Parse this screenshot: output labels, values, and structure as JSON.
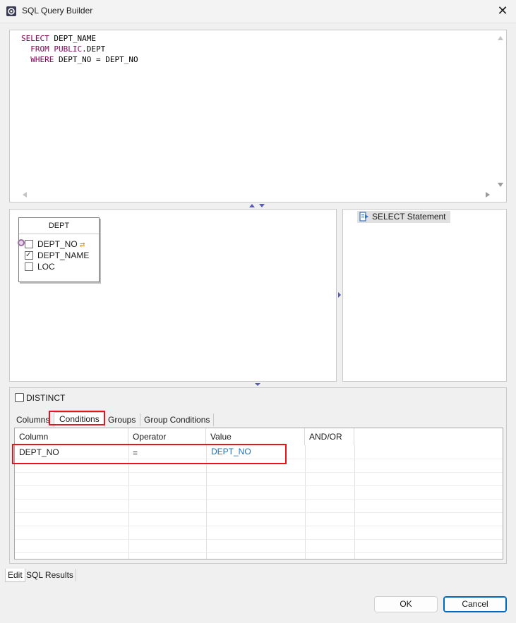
{
  "window": {
    "title": "SQL Query Builder",
    "close_glyph": "✕",
    "icon": "query-builder-icon"
  },
  "editor": {
    "lines": [
      {
        "parts": [
          {
            "t": "SELECT",
            "kw": true
          },
          {
            "t": " DEPT_NAME",
            "kw": false
          }
        ]
      },
      {
        "parts": [
          {
            "t": "  FROM",
            "kw": true
          },
          {
            "t": " ",
            "kw": false
          },
          {
            "t": "PUBLIC",
            "kw": true
          },
          {
            "t": ".DEPT",
            "kw": false
          }
        ]
      },
      {
        "parts": [
          {
            "t": "  WHERE",
            "kw": true
          },
          {
            "t": " DEPT_NO = DEPT_NO",
            "kw": false
          }
        ]
      }
    ]
  },
  "diagram": {
    "table": {
      "name": "DEPT",
      "columns": [
        {
          "label": "DEPT_NO",
          "checked": false,
          "key_marker": "⇄"
        },
        {
          "label": "DEPT_NAME",
          "checked": true,
          "key_marker": ""
        },
        {
          "label": "LOC",
          "checked": false,
          "key_marker": ""
        }
      ]
    }
  },
  "outline": {
    "node_label": "SELECT Statement"
  },
  "conditions_panel": {
    "distinct_label": "DISTINCT",
    "tabs": [
      "Columns",
      "Conditions",
      "Groups",
      "Group Conditions"
    ],
    "active_tab": "Conditions",
    "headers": [
      "Column",
      "Operator",
      "Value",
      "AND/OR"
    ],
    "rows": [
      {
        "column": "DEPT_NO",
        "operator": "=",
        "value": "DEPT_NO",
        "and_or": ""
      }
    ]
  },
  "bottom_tabs": {
    "edit": "Edit",
    "results": "SQL Results"
  },
  "buttons": {
    "ok": "OK",
    "cancel": "Cancel"
  },
  "colors": {
    "keyword": "#7f0055",
    "highlight": "#e8141b",
    "value_link": "#1f6fb2",
    "focus_border": "#0067c0"
  }
}
